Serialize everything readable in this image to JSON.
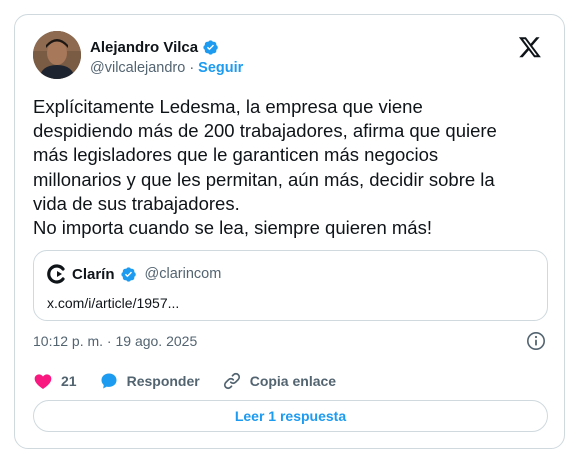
{
  "author": {
    "display_name": "Alejandro Vilca",
    "handle": "@vilcalejandro",
    "separator": "·",
    "follow_label": "Seguir"
  },
  "tweet": {
    "text": "Explícitamente Ledesma, la empresa que viene\ndespidiendo más de 200 trabajadores, afirma que quiere\nmás legisladores que le garanticen más negocios\nmillonarios y que les permitan, aún más, decidir sobre la\nvida de sus trabajadores.\nNo importa cuando se lea, siempre quieren más!",
    "timestamp": "10:12 p. m. · 19 ago. 2025"
  },
  "quote": {
    "display_name": "Clarín",
    "handle": "@clarincom",
    "link": "x.com/i/article/1957..."
  },
  "actions": {
    "likes": "21",
    "reply_label": "Responder",
    "copy_label": "Copia enlace"
  },
  "read_replies_label": "Leer 1 respuesta",
  "colors": {
    "accent": "#1d9bf0",
    "like": "#f91880",
    "text": "#0f1419",
    "muted": "#536471",
    "border": "#cfd9de"
  },
  "icons": [
    "verified-badge-icon",
    "x-logo-icon",
    "clarin-logo-icon",
    "info-icon",
    "heart-icon",
    "reply-bubble-icon",
    "link-icon"
  ]
}
